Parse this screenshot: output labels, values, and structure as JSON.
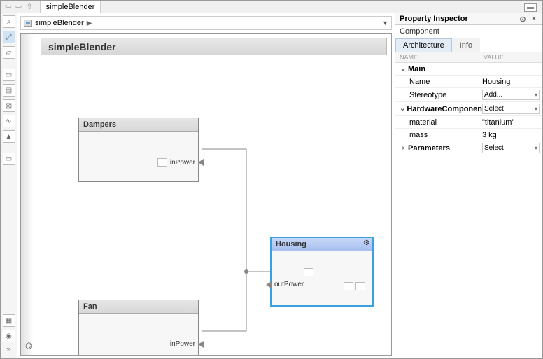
{
  "file_tab": "simpleBlender",
  "breadcrumb": {
    "model": "simpleBlender"
  },
  "canvas": {
    "title": "simpleBlender",
    "blocks": {
      "dampers": {
        "title": "Dampers",
        "port_out": "inPower"
      },
      "fan": {
        "title": "Fan",
        "port_out": "inPower"
      },
      "housing": {
        "title": "Housing",
        "port_in": "outPower"
      }
    }
  },
  "inspector": {
    "title": "Property Inspector",
    "subtitle": "Component",
    "tabs": {
      "arch": "Architecture",
      "info": "Info"
    },
    "columns": {
      "name": "NAME",
      "value": "VALUE"
    },
    "sections": {
      "main": {
        "label": "Main",
        "rows": {
          "name": {
            "label": "Name",
            "value": "Housing"
          },
          "stereotype": {
            "label": "Stereotype",
            "value": "Add..."
          }
        }
      },
      "hw": {
        "label": "HardwareComponent",
        "select": "Select",
        "rows": {
          "material": {
            "label": "material",
            "value": "\"titanium\""
          },
          "mass": {
            "label": "mass",
            "value": "3 kg"
          }
        }
      },
      "params": {
        "label": "Parameters",
        "select": "Select"
      }
    }
  }
}
